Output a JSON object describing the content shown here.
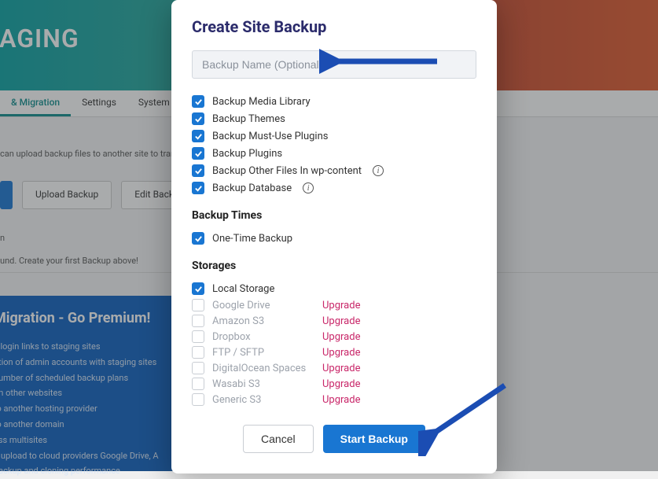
{
  "bg": {
    "header_title": "TAGING",
    "tabs": {
      "active": "& Migration",
      "settings": "Settings",
      "system": "System Info"
    },
    "hint": "can upload backup files to another site to tran",
    "upload": "Upload Backup",
    "edit": "Edit Backu",
    "small1": "n",
    "small2": "und. Create your first Backup above!",
    "promo_title": "Migration - Go Premium!",
    "promo_items": [
      "c login links to staging sites",
      "ation of admin accounts with staging sites",
      "number of scheduled backup plans",
      "on other websites",
      "to another hosting provider",
      "to another domain",
      "ess multisites",
      "p upload to cloud providers Google Drive, A",
      "backup and cloning performance"
    ]
  },
  "modal": {
    "title": "Create Site Backup",
    "placeholder": "Backup Name (Optional)",
    "checks": [
      {
        "label": "Backup Media Library"
      },
      {
        "label": "Backup Themes"
      },
      {
        "label": "Backup Must-Use Plugins"
      },
      {
        "label": "Backup Plugins"
      },
      {
        "label": "Backup Other Files In wp-content",
        "info": true
      },
      {
        "label": "Backup Database",
        "info": true
      }
    ],
    "times_h": "Backup Times",
    "one_time": "One-Time Backup",
    "storages_h": "Storages",
    "local": "Local Storage",
    "storages": [
      {
        "label": "Google Drive",
        "upgrade": "Upgrade"
      },
      {
        "label": "Amazon S3",
        "upgrade": "Upgrade"
      },
      {
        "label": "Dropbox",
        "upgrade": "Upgrade"
      },
      {
        "label": "FTP / SFTP",
        "upgrade": "Upgrade"
      },
      {
        "label": "DigitalOcean Spaces",
        "upgrade": "Upgrade"
      },
      {
        "label": "Wasabi S3",
        "upgrade": "Upgrade"
      },
      {
        "label": "Generic S3",
        "upgrade": "Upgrade"
      }
    ],
    "cancel": "Cancel",
    "start": "Start Backup"
  }
}
